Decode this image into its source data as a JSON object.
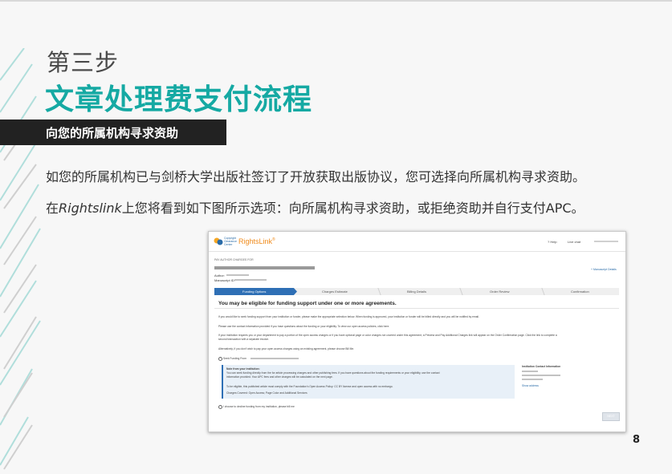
{
  "slide": {
    "step": "第三步",
    "title": "文章处理费支付流程",
    "band": "向您的所属机构寻求资助",
    "para1": "如您的所属机构已与剑桥大学出版社签订了开放获取出版协议，您可选择向所属机构寻求资助。",
    "para2_before": "在",
    "para2_italic": "Rightslink",
    "para2_after": "上您将看到如下图所示选项：向所属机构寻求资助，或拒绝资助并自行支付APC。",
    "page_number": "8"
  },
  "screenshot": {
    "logo_text": "Copyright Clearance Center",
    "brand": "RightsLink",
    "nav": {
      "help": "? Help",
      "live_chat": "Live chat"
    },
    "sub": "PAY AUTHOR CHARGES FOR",
    "author_label": "Author:",
    "manuscript_label": "Manuscript ID:",
    "manuscript_link": "+ Manuscript Details",
    "steps": [
      "Funding Options",
      "Charges Estimate",
      "Billing Details",
      "Order Review",
      "Confirmation"
    ],
    "heading": "You may be eligible for funding support under one or more agreements.",
    "lines": [
      "If you would like to seek funding support from your institution or funder, please make the appropriate selection below. When funding is approved, your institution or funder will be billed directly and you will be notified by email.",
      "Please use the contact information provided if you have questions about the funding or your eligibility. To view our open access policies, click here.",
      "If your institution requires you or your department to pay a portion of the open access charges or if you have optional page or color charges not covered under this agreement, a Preview and Pay Additional Charges link will appear on the Order Confirmation page. Click the link to complete a",
      "second transaction with a separate invoice.",
      "Alternatively, if you don't wish to pay your open access charges using an existing agreement, please choose Bill Me."
    ],
    "option1": "Seek Funding From",
    "note_title": "Note from your institution:",
    "note_line1": "You can seek funding directly from the for article processing charges and other publishing fees. If you have questions about the funding requirements or your eligibility, use the contact",
    "note_line2": "information provided.  Your APC fees and other charges will be calculated on the next page.",
    "note_line3": "To be eligible, this published article must comply with the Foundation's Open Access Policy: CC BY license and open access with no embargo.",
    "note_line4": "Charges Covered: Open Access; Page Color and Additional Services",
    "contact_title": "Institution Contact Information",
    "show_address": "Show address",
    "option2": "I choose to decline funding from my institution, please bill me",
    "next": "NEXT"
  },
  "colors": {
    "accent": "#15a9a3",
    "band": "#222222",
    "progress": "#2e6fb5",
    "brand": "#f08b1c"
  }
}
